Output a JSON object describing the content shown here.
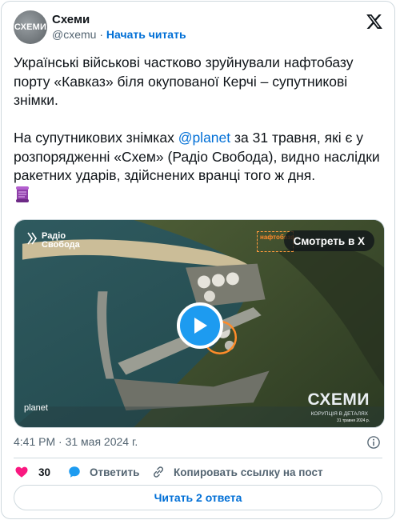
{
  "author": {
    "avatar_text": "СХЕМИ",
    "name": "Схеми",
    "handle": "@cxemu",
    "separator": "·",
    "follow_label": "Начать читать"
  },
  "tweet": {
    "paragraph1": "Українські військові частково зруйнували нафтобазу порту «Кавказ» біля окупованої Керчі – супутникові знімки.",
    "paragraph2_before": "На супутникових знімках ",
    "mention": "@planet",
    "paragraph2_after": " за 31 травня, які є у розпорядженні «Схем» (Радіо Свобода), видно наслідки ракетних ударів, здійснених вранці того ж дня."
  },
  "media": {
    "watch_label": "Смотреть в X",
    "radio_logo": "Радіо\nСвобода",
    "planet_mark": "planet",
    "schemy_logo": "СХЕМИ",
    "schemy_sub": "КОРУПЦІЯ В ДЕТАЛЯХ",
    "photo_date": "31 травня 2024 р.",
    "label_box": "нафтобаза"
  },
  "meta": {
    "timestamp": "4:41 PM · 31 мая 2024 г."
  },
  "actions": {
    "like_count": "30",
    "reply_label": "Ответить",
    "copy_label": "Копировать ссылку на пост"
  },
  "footer": {
    "read_replies_label": "Читать 2 ответа"
  },
  "colors": {
    "accent": "#006fd6",
    "like": "#f91880",
    "play": "#1d9bf0"
  }
}
